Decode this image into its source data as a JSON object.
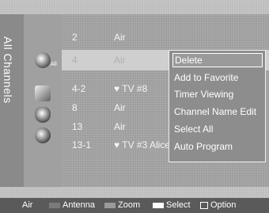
{
  "sidebar": {
    "title": "All Channels"
  },
  "icons": {
    "all_label": "All"
  },
  "channels": [
    {
      "number": "2",
      "type": "Air",
      "name": ""
    },
    {
      "number": "4",
      "type": "Air",
      "name": ""
    },
    {
      "number": "4-2",
      "type": "♥ TV #8",
      "name": ""
    },
    {
      "number": "8",
      "type": "Air",
      "name": ""
    },
    {
      "number": "13",
      "type": "Air",
      "name": ""
    },
    {
      "number": "13-1",
      "type": "♥ TV #3",
      "name": "Alice"
    }
  ],
  "popup_menu": {
    "items": [
      {
        "label": "Delete"
      },
      {
        "label": "Add to Favorite"
      },
      {
        "label": "Timer Viewing"
      },
      {
        "label": "Channel Name Edit"
      },
      {
        "label": "Select All"
      },
      {
        "label": "Auto Program"
      }
    ],
    "active_index": 0
  },
  "bottom_bar": {
    "air": "Air",
    "antenna": "Antenna",
    "zoom": "Zoom",
    "select": "Select",
    "option": "Option"
  },
  "colors": {
    "antenna_swatch": "#7a7a7a",
    "zoom_swatch": "#9a9a9a",
    "select_swatch": "#ffffff"
  }
}
